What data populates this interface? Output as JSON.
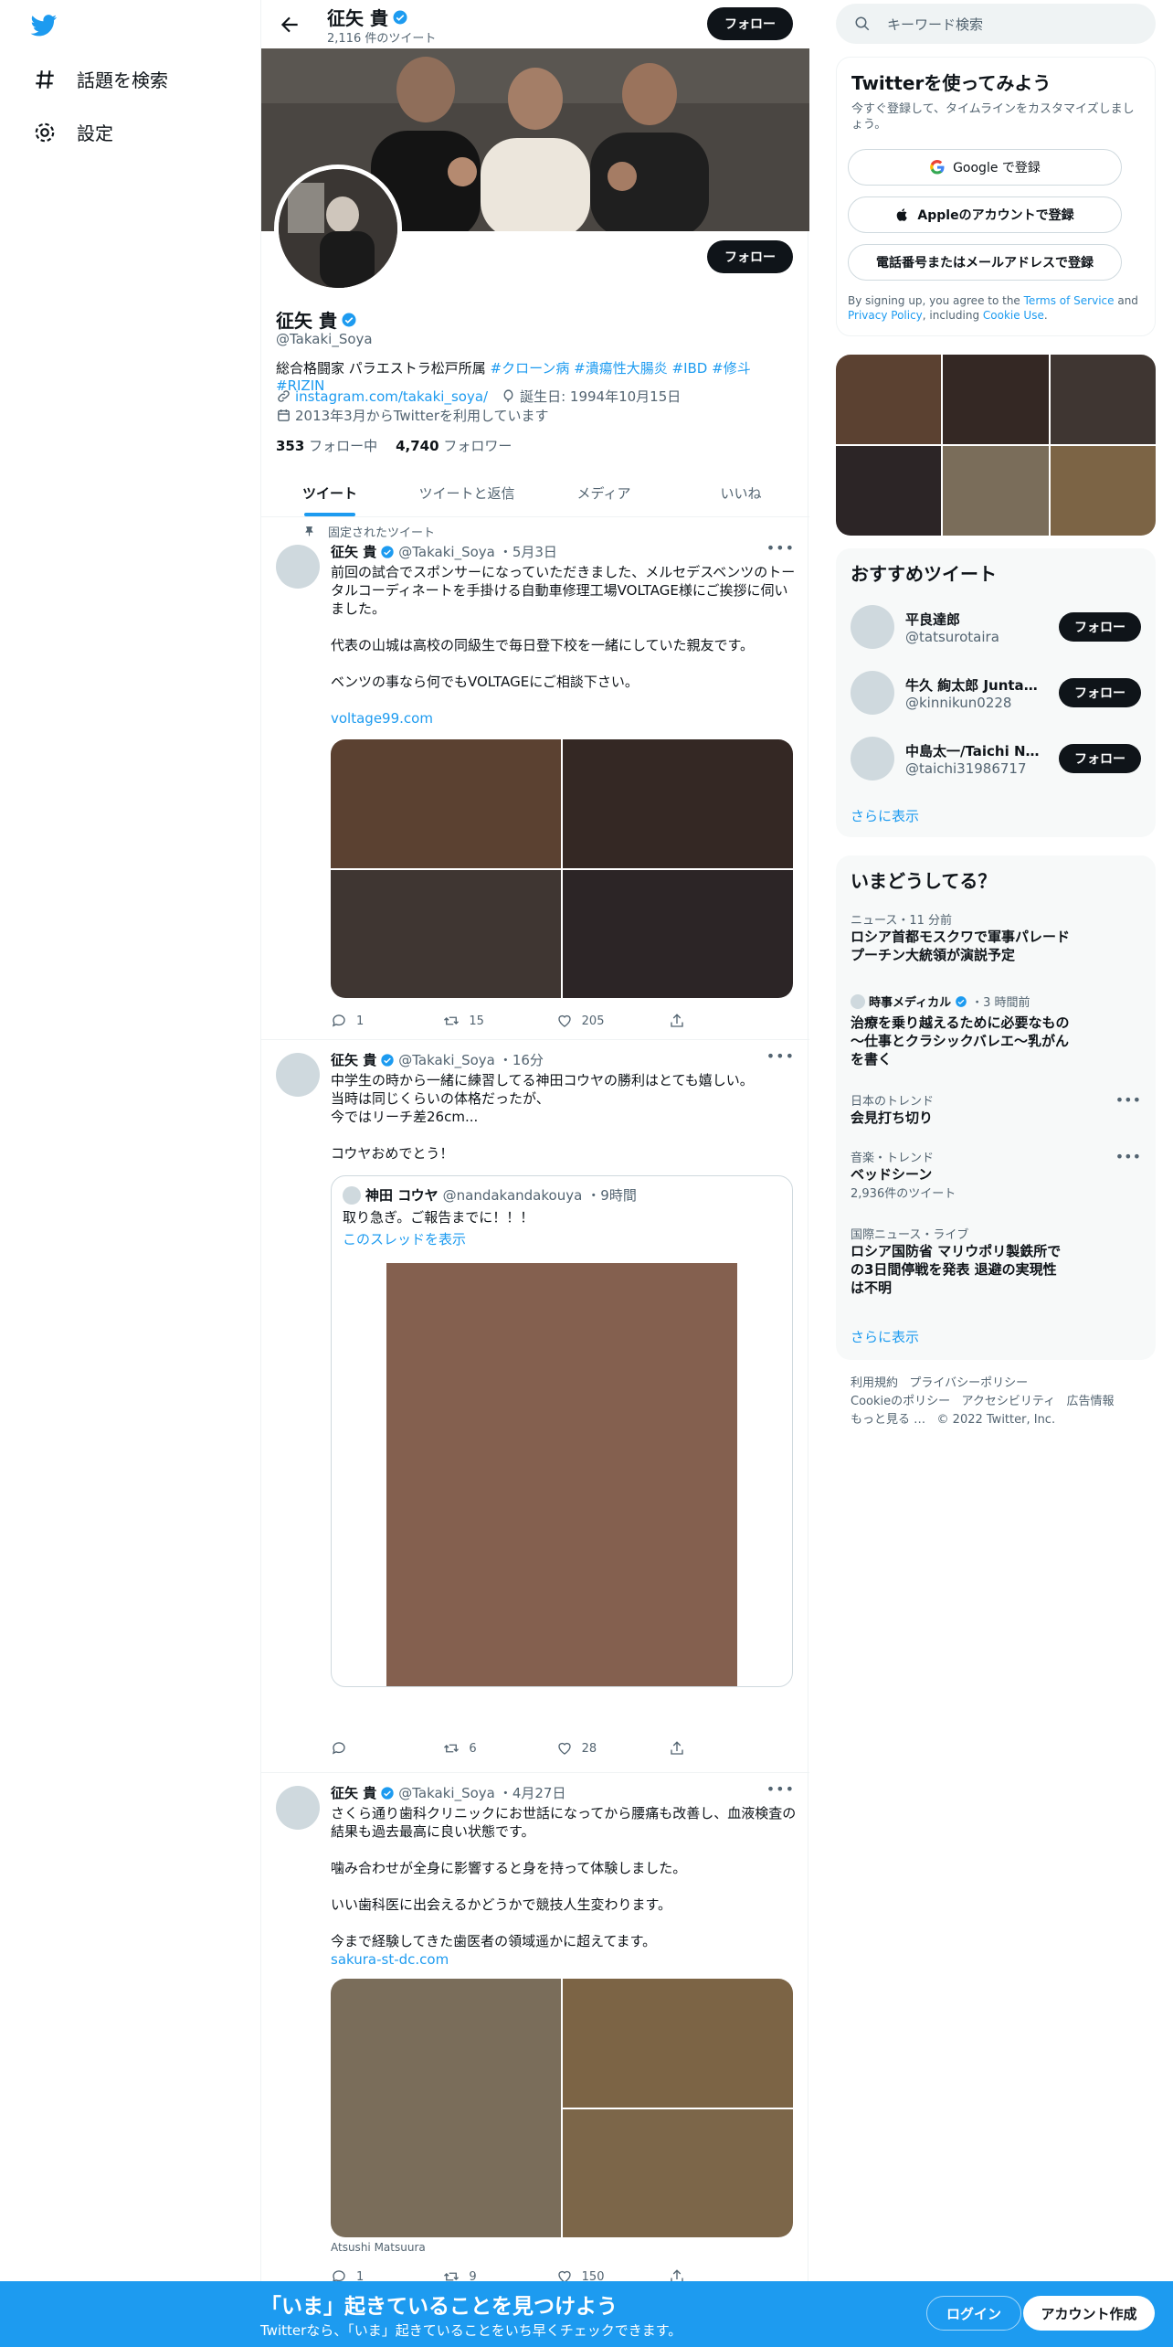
{
  "nav": {
    "explore_label": "話題を検索",
    "settings_label": "設定"
  },
  "header": {
    "name": "征矢 貴",
    "tweet_count": "2,116 件のツイート",
    "follow_label": "フォロー"
  },
  "profile": {
    "name": "征矢 貴",
    "handle": "@Takaki_Soya",
    "bio_text": "総合格闘家 パラエストラ松戸所属 ",
    "bio_tags": [
      "#クローン病",
      "#潰瘍性大腸炎",
      "#IBD",
      "#修斗",
      "#RIZIN"
    ],
    "url": "instagram.com/takaki_soya/",
    "birthday": "誕生日: 1994年10月15日",
    "joined": "2013年3月からTwitterを利用しています",
    "following_count": "353",
    "following_label": "フォロー中",
    "followers_count": "4,740",
    "followers_label": "フォロワー",
    "follow_label": "フォロー"
  },
  "tabs": [
    "ツイート",
    "ツイートと返信",
    "メディア",
    "いいね"
  ],
  "tweets": [
    {
      "pinned_label": "固定されたツイート",
      "name": "征矢 貴",
      "handle": "@Takaki_Soya",
      "time": "・5月3日",
      "text": "前回の試合でスポンサーになっていただきました、メルセデスベンツのトータルコーディネートを手掛ける自動車修理工場VOLTAGE様にご挨拶に伺いました。\n\n代表の山城は高校の同級生で毎日登下校を一緒にしていた親友です。\n\nベンツの事なら何でもVOLTAGEにご相談下さい。",
      "link": "voltage99.com",
      "media_colors": [
        "#5b4131",
        "#342824",
        "#3f3632",
        "#2c2526"
      ],
      "replies": "1",
      "retweets": "15",
      "likes": "205"
    },
    {
      "name": "征矢 貴",
      "handle": "@Takaki_Soya",
      "time": "・16分",
      "text": "中学生の時から一緒に練習してる神田コウヤの勝利はとても嬉しい。\n当時は同じくらいの体格だったが、\n今ではリーチ差26cm...\n\nコウヤおめでとう！",
      "quote": {
        "name": "神田 コウヤ",
        "handle": "@nandakandakouya",
        "time": "・9時間",
        "text": "取り急ぎ。ご報告までに！！！",
        "thread_link": "このスレッドを表示",
        "media_color": "#84604f"
      },
      "replies": "",
      "retweets": "6",
      "likes": "28"
    },
    {
      "name": "征矢 貴",
      "handle": "@Takaki_Soya",
      "time": "・4月27日",
      "text": "さくら通り歯科クリニックにお世話になってから腰痛も改善し、血液検査の結果も過去最高に良い状態です。\n\n噛み合わせが全身に影響すると身を持って体験しました。\n\nいい歯科医に出会えるかどうかで競技人生変わります。\n\n今まで経験してきた歯医者の領域遥かに超えてます。",
      "link": "sakura-st-dc.com",
      "media_colors": [
        "#7a6d5a",
        "#7c6445",
        "#7c6649"
      ],
      "caption": "Atsushi Matsuura",
      "replies": "1",
      "retweets": "9",
      "likes": "150"
    }
  ],
  "search": {
    "placeholder": "キーワード検索"
  },
  "signup_card": {
    "title": "Twitterを使ってみよう",
    "subtitle": "今すぐ登録して、タイムラインをカスタマイズしましょう。",
    "google": "Google で登録",
    "apple": "Appleのアカウントで登録",
    "phone": "電話番号またはメールアドレスで登録",
    "terms_1": "By signing up, you agree to the ",
    "terms_link": "Terms of Service",
    "terms_2": " and ",
    "privacy_link": "Privacy Policy",
    "terms_3": ", including ",
    "cookie_link": "Cookie Use",
    "terms_4": "."
  },
  "photo_colors": [
    "#5b4131",
    "#342824",
    "#3f3632",
    "#2c2526",
    "#7a6d5a",
    "#7c6445"
  ],
  "suggestions": {
    "title": "おすすめツイート",
    "users": [
      {
        "name": "平良達郎",
        "handle": "@tatsurotaira"
      },
      {
        "name": "牛久 絢太郎 Juntaro Us...",
        "handle": "@kinnikun0228"
      },
      {
        "name": "中島太一/Taichi Nakaj...",
        "handle": "@taichi31986717"
      }
    ],
    "follow_label": "フォロー",
    "more": "さらに表示"
  },
  "trends": {
    "title": "いまどうしてる？",
    "items": [
      {
        "category": "ニュース・11 分前",
        "title": "ロシア首都モスクワで軍事パレード プーチン大統領が演説予定"
      },
      {
        "category": "時事メディカル",
        "category_time": "・3 時間前",
        "title": "治療を乗り越えるために必要なもの～仕事とクラシックバレエ～乳がんを書く"
      },
      {
        "category": "日本のトレンド",
        "title": "会見打ち切り"
      },
      {
        "category": "音楽・トレンド",
        "title": "ベッドシーン",
        "count": "2,936件のツイート"
      },
      {
        "category": "国際ニュース・ライブ",
        "title": "ロシア国防省 マリウポリ製鉄所での3日間停戦を発表 退避の実現性は不明"
      }
    ],
    "more": "さらに表示"
  },
  "footer": {
    "links": [
      "利用規約",
      "プライバシーポリシー",
      "Cookieのポリシー",
      "アクセシビリティ",
      "広告情報",
      "もっと見る …",
      "© 2022 Twitter, Inc."
    ]
  },
  "bottom_bar": {
    "title": "「いま」起きていることを見つけよう",
    "subtitle": "Twitterなら、「いま」起きていることをいち早くチェックできます。",
    "login": "ログイン",
    "signup": "アカウント作成"
  }
}
